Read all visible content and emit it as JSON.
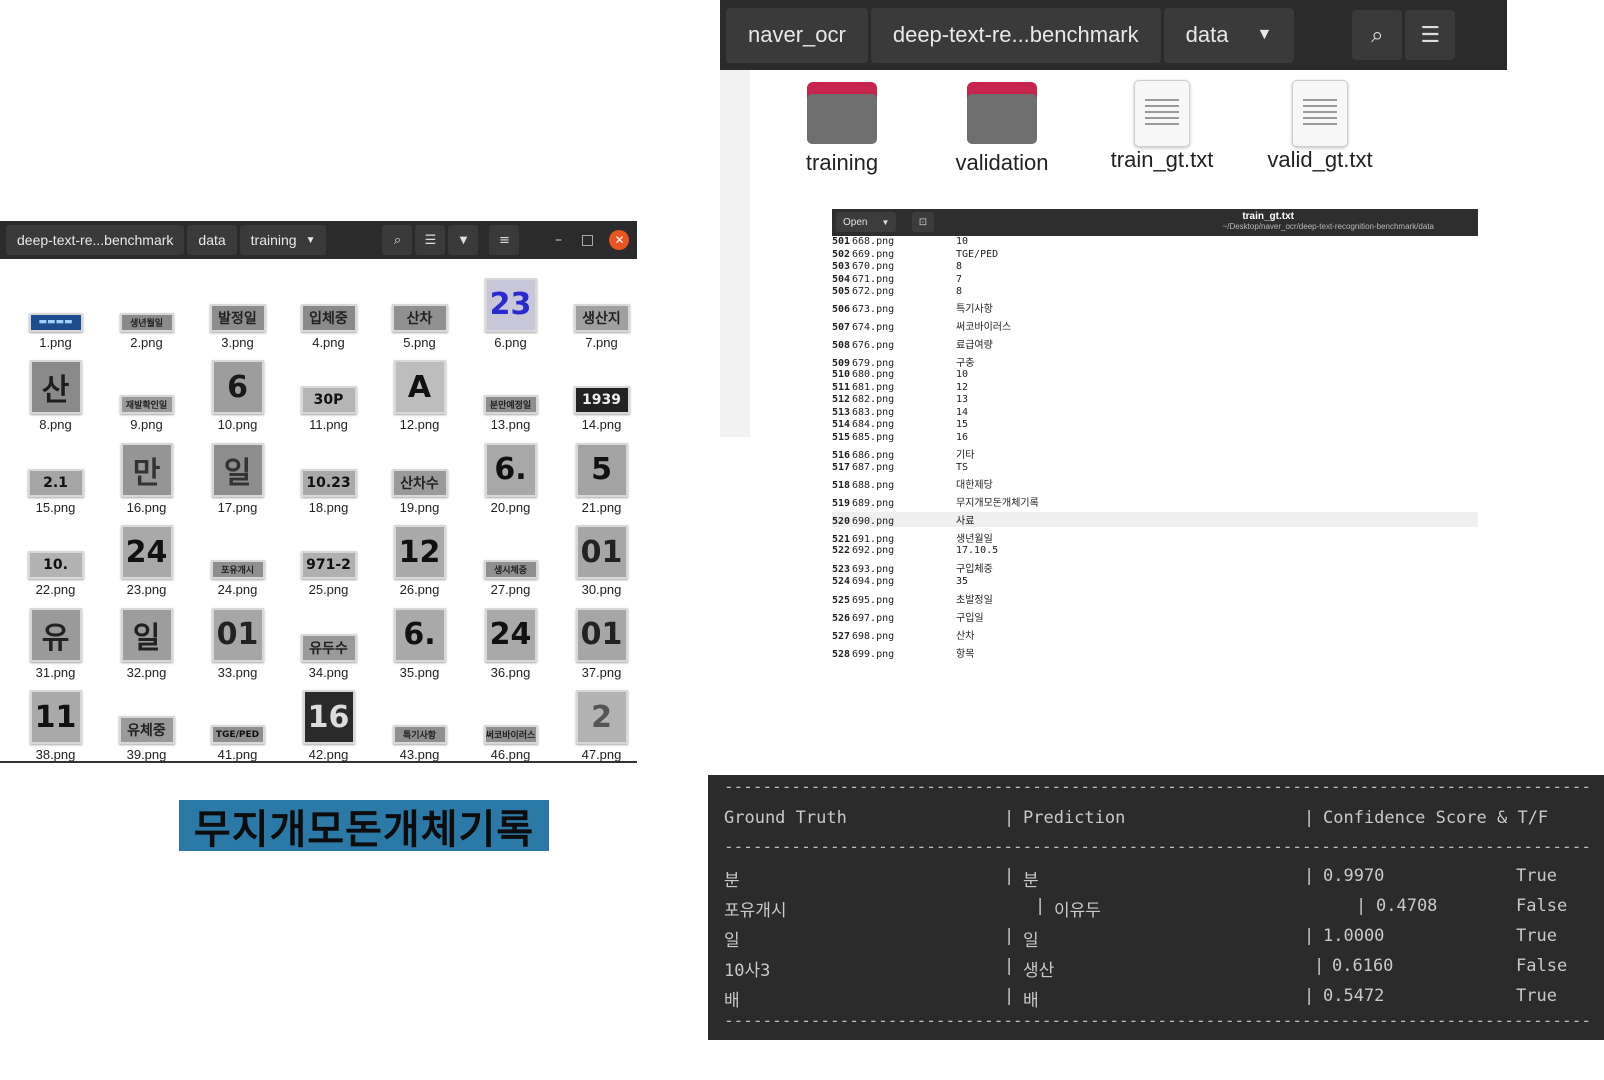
{
  "left_fm": {
    "breadcrumbs": [
      "deep-text-re...benchmark",
      "data",
      "training"
    ],
    "thumbs": [
      {
        "name": "1.png",
        "kind": "strip",
        "text": "▬▬▬▬",
        "bg": "#1d4d8f",
        "fg": "#9fd0ff"
      },
      {
        "name": "2.png",
        "kind": "strip",
        "text": "생년월일",
        "bg": "#8a8a8a",
        "fg": "#222"
      },
      {
        "name": "3.png",
        "kind": "wide",
        "text": "발정일",
        "bg": "#8d8d8d",
        "fg": "#222"
      },
      {
        "name": "4.png",
        "kind": "wide",
        "text": "입체중",
        "bg": "#8a8a8a",
        "fg": "#222"
      },
      {
        "name": "5.png",
        "kind": "wide",
        "text": "산차",
        "bg": "#909090",
        "fg": "#222"
      },
      {
        "name": "6.png",
        "kind": "square",
        "text": "23",
        "bg": "#c7c7d8",
        "fg": "#2a2ad0"
      },
      {
        "name": "7.png",
        "kind": "wide",
        "text": "생산지",
        "bg": "#a0a0a0",
        "fg": "#222"
      },
      {
        "name": "8.png",
        "kind": "square",
        "text": "산",
        "bg": "#8a8a8a",
        "fg": "#1d1d1d"
      },
      {
        "name": "9.png",
        "kind": "strip",
        "text": "재발확인일",
        "bg": "#9a9a9a",
        "fg": "#222"
      },
      {
        "name": "10.png",
        "kind": "square",
        "text": "6",
        "bg": "#9d9d9d",
        "fg": "#1a1a1a"
      },
      {
        "name": "11.png",
        "kind": "wide",
        "text": "30P",
        "bg": "#b5b5b5",
        "fg": "#111"
      },
      {
        "name": "12.png",
        "kind": "square",
        "text": "A",
        "bg": "#bdbdbd",
        "fg": "#111"
      },
      {
        "name": "13.png",
        "kind": "strip",
        "text": "분만예정일",
        "bg": "#8f8f8f",
        "fg": "#222"
      },
      {
        "name": "14.png",
        "kind": "wide",
        "text": "1939",
        "bg": "#222",
        "fg": "#eee"
      },
      {
        "name": "15.png",
        "kind": "wide",
        "text": "2.1",
        "bg": "#a5a5a5",
        "fg": "#111"
      },
      {
        "name": "16.png",
        "kind": "square",
        "text": "만",
        "bg": "#959595",
        "fg": "#333"
      },
      {
        "name": "17.png",
        "kind": "square",
        "text": "일",
        "bg": "#8d8d8d",
        "fg": "#333"
      },
      {
        "name": "18.png",
        "kind": "wide",
        "text": "10.23",
        "bg": "#a9a9a9",
        "fg": "#111"
      },
      {
        "name": "19.png",
        "kind": "wide",
        "text": "산차수",
        "bg": "#9a9a9a",
        "fg": "#222"
      },
      {
        "name": "20.png",
        "kind": "square",
        "text": "6.",
        "bg": "#a8a8a8",
        "fg": "#111"
      },
      {
        "name": "21.png",
        "kind": "square",
        "text": "5",
        "bg": "#a3a3a3",
        "fg": "#111"
      },
      {
        "name": "22.png",
        "kind": "wide",
        "text": "10.",
        "bg": "#b3b3b3",
        "fg": "#111"
      },
      {
        "name": "23.png",
        "kind": "square",
        "text": "24",
        "bg": "#a9a9a9",
        "fg": "#111"
      },
      {
        "name": "24.png",
        "kind": "strip",
        "text": "포유개시",
        "bg": "#8f8f8f",
        "fg": "#222"
      },
      {
        "name": "25.png",
        "kind": "wide",
        "text": "971-2",
        "bg": "#b0b0b0",
        "fg": "#111"
      },
      {
        "name": "26.png",
        "kind": "square",
        "text": "12",
        "bg": "#a9a9a9",
        "fg": "#111"
      },
      {
        "name": "27.png",
        "kind": "strip",
        "text": "생시체중",
        "bg": "#8f8f8f",
        "fg": "#222"
      },
      {
        "name": "30.png",
        "kind": "square",
        "text": "01",
        "bg": "#a6a6a6",
        "fg": "#222"
      },
      {
        "name": "31.png",
        "kind": "square",
        "text": "유",
        "bg": "#9a9a9a",
        "fg": "#222"
      },
      {
        "name": "32.png",
        "kind": "square",
        "text": "일",
        "bg": "#9d9d9d",
        "fg": "#222"
      },
      {
        "name": "33.png",
        "kind": "square",
        "text": "01",
        "bg": "#a6a6a6",
        "fg": "#222"
      },
      {
        "name": "34.png",
        "kind": "wide",
        "text": "유두수",
        "bg": "#9a9a9a",
        "fg": "#222"
      },
      {
        "name": "35.png",
        "kind": "square",
        "text": "6.",
        "bg": "#a9a9a9",
        "fg": "#111"
      },
      {
        "name": "36.png",
        "kind": "square",
        "text": "24",
        "bg": "#a9a9a9",
        "fg": "#111"
      },
      {
        "name": "37.png",
        "kind": "square",
        "text": "01",
        "bg": "#a6a6a6",
        "fg": "#222"
      },
      {
        "name": "38.png",
        "kind": "square",
        "text": "11",
        "bg": "#a9a9a9",
        "fg": "#111"
      },
      {
        "name": "39.png",
        "kind": "wide",
        "text": "유체중",
        "bg": "#9a9a9a",
        "fg": "#222"
      },
      {
        "name": "41.png",
        "kind": "strip",
        "text": "TGE/PED",
        "bg": "#8f8f8f",
        "fg": "#111"
      },
      {
        "name": "42.png",
        "kind": "square",
        "text": "16",
        "bg": "#2a2a2a",
        "fg": "#ddd"
      },
      {
        "name": "43.png",
        "kind": "strip",
        "text": "특기사항",
        "bg": "#8f8f8f",
        "fg": "#222"
      },
      {
        "name": "46.png",
        "kind": "strip",
        "text": "써코바이러스",
        "bg": "#8f8f8f",
        "fg": "#222"
      },
      {
        "name": "47.png",
        "kind": "square",
        "text": "2",
        "bg": "#b3b3b3",
        "fg": "#555"
      }
    ],
    "banner_text": "무지개모돈개체기록"
  },
  "right_fm": {
    "breadcrumbs": [
      "naver_ocr",
      "deep-text-re...benchmark",
      "data"
    ],
    "items": [
      {
        "label": "training",
        "type": "folder"
      },
      {
        "label": "validation",
        "type": "folder"
      },
      {
        "label": "train_gt.txt",
        "type": "text"
      },
      {
        "label": "valid_gt.txt",
        "type": "text"
      }
    ]
  },
  "editor": {
    "open_label": "Open",
    "title": "train_gt.txt",
    "path": "~/Desktop/naver_ocr/deep-text-recognition-benchmark/data",
    "lines": [
      {
        "n": "501",
        "file": "668.png",
        "label": "10"
      },
      {
        "n": "502",
        "file": "669.png",
        "label": "TGE/PED"
      },
      {
        "n": "503",
        "file": "670.png",
        "label": "8"
      },
      {
        "n": "504",
        "file": "671.png",
        "label": "7"
      },
      {
        "n": "505",
        "file": "672.png",
        "label": "8"
      },
      {
        "n": "506",
        "file": "673.png",
        "label": "특기사항"
      },
      {
        "n": "507",
        "file": "674.png",
        "label": "써코바이러스"
      },
      {
        "n": "508",
        "file": "676.png",
        "label": "료급여량"
      },
      {
        "n": "509",
        "file": "679.png",
        "label": "구충"
      },
      {
        "n": "510",
        "file": "680.png",
        "label": "10"
      },
      {
        "n": "511",
        "file": "681.png",
        "label": "12"
      },
      {
        "n": "512",
        "file": "682.png",
        "label": "13"
      },
      {
        "n": "513",
        "file": "683.png",
        "label": "14"
      },
      {
        "n": "514",
        "file": "684.png",
        "label": "15"
      },
      {
        "n": "515",
        "file": "685.png",
        "label": "16"
      },
      {
        "n": "516",
        "file": "686.png",
        "label": "기타"
      },
      {
        "n": "517",
        "file": "687.png",
        "label": "TS"
      },
      {
        "n": "518",
        "file": "688.png",
        "label": "대한제당"
      },
      {
        "n": "519",
        "file": "689.png",
        "label": "무지개모돈개체기록"
      },
      {
        "n": "520",
        "file": "690.png",
        "label": "사료"
      },
      {
        "n": "521",
        "file": "691.png",
        "label": "생년월일"
      },
      {
        "n": "522",
        "file": "692.png",
        "label": "17.10.5"
      },
      {
        "n": "523",
        "file": "693.png",
        "label": "구입체중"
      },
      {
        "n": "524",
        "file": "694.png",
        "label": "35"
      },
      {
        "n": "525",
        "file": "695.png",
        "label": "초발정일"
      },
      {
        "n": "526",
        "file": "697.png",
        "label": "구입일"
      },
      {
        "n": "527",
        "file": "698.png",
        "label": "산차"
      },
      {
        "n": "528",
        "file": "699.png",
        "label": "항목"
      }
    ],
    "current_line": "520"
  },
  "terminal": {
    "headers": [
      "Ground Truth",
      "Prediction",
      "Confidence Score & T/F"
    ],
    "rows": [
      {
        "gt": "분",
        "pred": "분",
        "score": "0.9970",
        "tf": "True"
      },
      {
        "gt": "포유개시",
        "pred": "이유두",
        "score": "0.4708",
        "tf": "False"
      },
      {
        "gt": "일",
        "pred": "일",
        "score": "1.0000",
        "tf": "True"
      },
      {
        "gt": "10사3",
        "pred": "생산",
        "score": "0.6160",
        "tf": "False"
      },
      {
        "gt": "배",
        "pred": "배",
        "score": "0.5472",
        "tf": "True"
      }
    ]
  }
}
